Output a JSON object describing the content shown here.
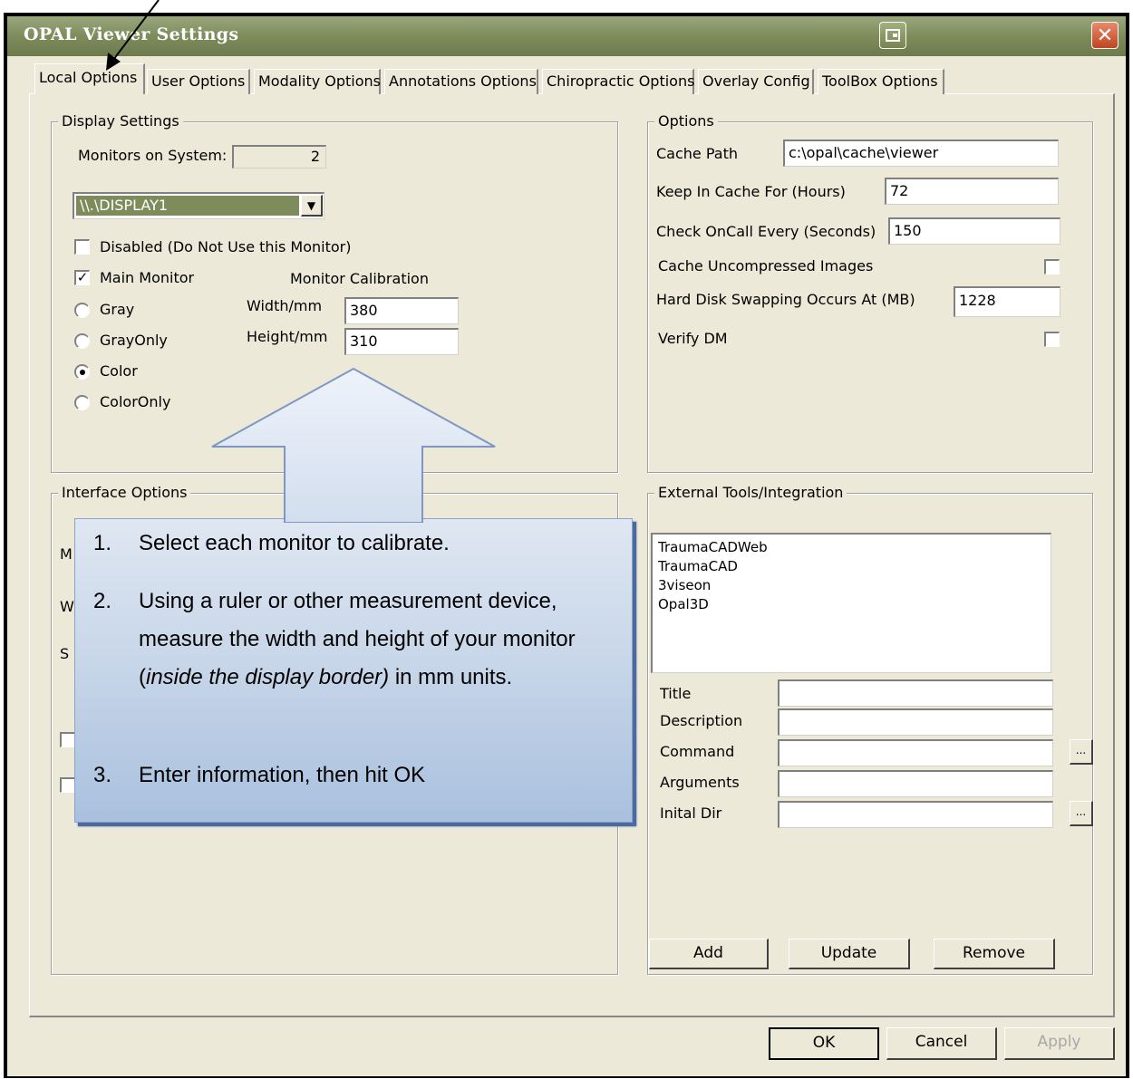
{
  "window": {
    "title": "OPAL Viewer Settings",
    "close_glyph": "✕"
  },
  "tabs": [
    {
      "label": "Local Options"
    },
    {
      "label": "User Options"
    },
    {
      "label": "Modality Options"
    },
    {
      "label": "Annotations Options"
    },
    {
      "label": "Chiropractic Options"
    },
    {
      "label": "Overlay Config"
    },
    {
      "label": "ToolBox Options"
    }
  ],
  "display_settings": {
    "title": "Display Settings",
    "monitors_label": "Monitors on System:",
    "monitors_value": "2",
    "selected_display": "\\\\.\\DISPLAY1",
    "disabled_label": "Disabled (Do Not Use this Monitor)",
    "disabled_checked": false,
    "main_monitor_label": "Main Monitor",
    "main_monitor_checked": true,
    "color_modes": [
      {
        "label": "Gray",
        "selected": false
      },
      {
        "label": "GrayOnly",
        "selected": false
      },
      {
        "label": "Color",
        "selected": true
      },
      {
        "label": "ColorOnly",
        "selected": false
      }
    ],
    "calibration_title": "Monitor Calibration",
    "width_label": "Width/mm",
    "width_value": "380",
    "height_label": "Height/mm",
    "height_value": "310"
  },
  "interface_options": {
    "title": "Interface Options",
    "partial_labels": [
      "M",
      "W",
      "S"
    ]
  },
  "options": {
    "title": "Options",
    "cache_path_label": "Cache Path",
    "cache_path_value": "c:\\opal\\cache\\viewer",
    "keep_cache_label": "Keep In Cache For (Hours)",
    "keep_cache_value": "72",
    "check_oncall_label": "Check OnCall Every (Seconds)",
    "check_oncall_value": "150",
    "cache_uncompressed_label": "Cache Uncompressed Images",
    "cache_uncompressed_checked": false,
    "swap_label": "Hard Disk Swapping Occurs At (MB)",
    "swap_value": "1228",
    "verify_dm_label": "Verify DM",
    "verify_dm_checked": false
  },
  "external_tools": {
    "title": "External Tools/Integration",
    "items": [
      "TraumaCADWeb",
      "TraumaCAD",
      "3viseon",
      "Opal3D"
    ],
    "title_label": "Title",
    "description_label": "Description",
    "command_label": "Command",
    "arguments_label": "Arguments",
    "initial_dir_label": "Inital Dir",
    "browse_label": "...",
    "add_label": "Add",
    "update_label": "Update",
    "remove_label": "Remove"
  },
  "footer": {
    "ok_label": "OK",
    "cancel_label": "Cancel",
    "apply_label": "Apply"
  },
  "callout": {
    "steps": [
      {
        "num": "1.",
        "text": "Select each monitor to calibrate."
      },
      {
        "num": "2.",
        "text_before": "Using a ruler or other measurement device, measure the width and height of your monitor (",
        "text_italic": "inside the display border)",
        "text_after": " in mm units."
      },
      {
        "num": "3.",
        "text": "Enter information, then hit OK"
      }
    ]
  }
}
